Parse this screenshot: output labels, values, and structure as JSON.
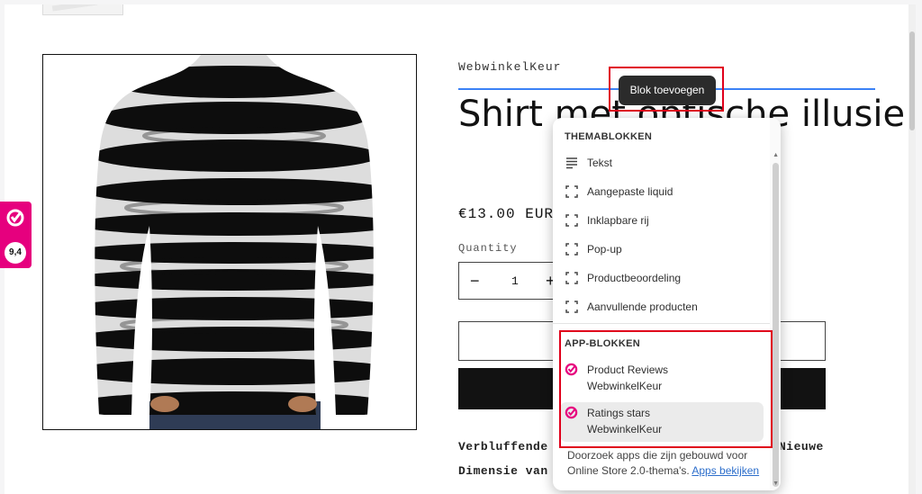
{
  "product": {
    "vendor": "WebwinkelKeur",
    "title": "Shirt met optische illusie",
    "price": "€13.00 EUR",
    "quantity_label": "Quantity",
    "quantity_value": "1",
    "quantity_minus": "−",
    "quantity_plus": "+",
    "description_line1": "Verbluffende",
    "description_line2": "Dimensie van",
    "description_tail": "Nieuwe"
  },
  "badge": {
    "score": "9,4",
    "brand_color": "#e6007e"
  },
  "tooltip": {
    "label": "Blok toevoegen"
  },
  "dropdown": {
    "theme_header": "THEMABLOKKEN",
    "theme_items": [
      {
        "label": "Tekst",
        "icon": "text-lines-icon"
      },
      {
        "label": "Aangepaste liquid",
        "icon": "dashed-square-icon"
      },
      {
        "label": "Inklapbare rij",
        "icon": "dashed-square-icon"
      },
      {
        "label": "Pop-up",
        "icon": "dashed-square-icon"
      },
      {
        "label": "Productbeoordeling",
        "icon": "dashed-square-icon"
      },
      {
        "label": "Aanvullende producten",
        "icon": "dashed-square-icon"
      }
    ],
    "app_header": "APP-BLOKKEN",
    "app_items": [
      {
        "label": "Product Reviews",
        "provider": "WebwinkelKeur",
        "icon": "webwinkelkeur-icon"
      },
      {
        "label": "Ratings stars",
        "provider": "WebwinkelKeur",
        "icon": "webwinkelkeur-icon"
      }
    ],
    "footer_text": "Doorzoek apps die zijn gebouwd voor Online Store 2.0-thema's.",
    "footer_link": "Apps bekijken"
  },
  "colors": {
    "accent_blue": "#3b82f6",
    "highlight_red": "#e0001b",
    "link_blue": "#2c6ecb"
  }
}
